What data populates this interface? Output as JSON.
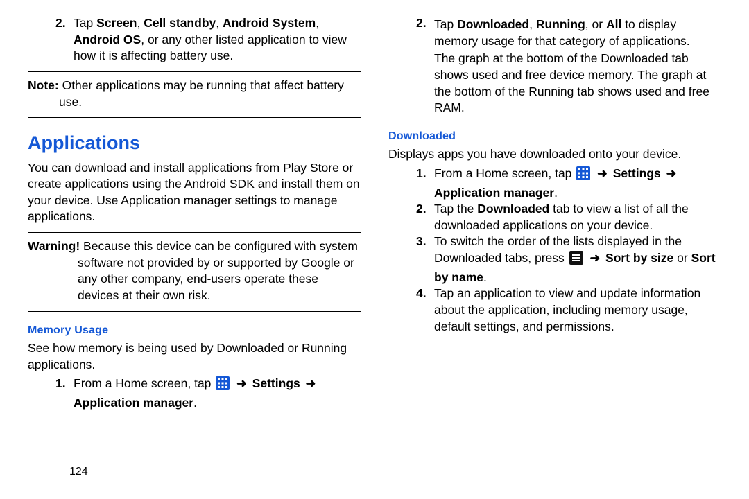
{
  "pageNumber": "124",
  "left": {
    "step2_pre": "Tap ",
    "step2_boldA": "Screen",
    "step2_mid1": ", ",
    "step2_boldB": "Cell standby",
    "step2_mid2": ", ",
    "step2_boldC": "Android System",
    "step2_mid3": ", ",
    "step2_boldD": "Android OS",
    "step2_tail": ", or any other listed application to view how it is affecting battery use.",
    "note_label": "Note:",
    "note_text": " Other applications may be running that affect battery use.",
    "h1": "Applications",
    "apps_para": "You can download and install applications from Play Store or create applications using the Android SDK and install them on your device. Use Application manager settings to manage applications.",
    "warn_label": "Warning!",
    "warn_text": " Because this device can be configured with system software not provided by or supported by Google or any other company, end-users operate these devices at their own risk.",
    "mem_h3": "Memory Usage",
    "mem_para": "See how memory is being used by Downloaded or Running applications.",
    "mem_s1_pre": "From a Home screen, tap ",
    "mem_s1_settings": "Settings",
    "mem_s1_appmgr": "Application manager",
    "mem_s1_dot": "."
  },
  "right": {
    "step2_pre": "Tap ",
    "step2_b1": "Downloaded",
    "step2_m1": ", ",
    "step2_b2": "Running",
    "step2_m2": ", or ",
    "step2_b3": "All",
    "step2_tail": " to display memory usage for that category of applications.",
    "step2_para2": "The graph at the bottom of the Downloaded tab shows used and free device memory. The graph at the bottom of the Running tab shows used and free RAM.",
    "dl_h3": "Downloaded",
    "dl_para": "Displays apps you have downloaded onto your device.",
    "dl_s1_pre": "From a Home screen, tap ",
    "dl_s1_settings": "Settings",
    "dl_s1_appmgr": "Application manager",
    "dl_s1_dot": ".",
    "dl_s2_pre": "Tap the ",
    "dl_s2_bold": "Downloaded",
    "dl_s2_tail": " tab to view a list of all the downloaded applications on your device.",
    "dl_s3_pre": "To switch the order of the lists displayed in the Downloaded tabs, press ",
    "dl_s3_sortsize": "Sort by size",
    "dl_s3_or": " or ",
    "dl_s3_sortname": "Sort by name",
    "dl_s3_dot": ".",
    "dl_s4": "Tap an application to view and update information about the application, including memory usage, default settings, and permissions."
  },
  "numerals": {
    "n1": "1.",
    "n2": "2.",
    "n3": "3.",
    "n4": "4."
  },
  "glyphs": {
    "arrow": "➜"
  }
}
